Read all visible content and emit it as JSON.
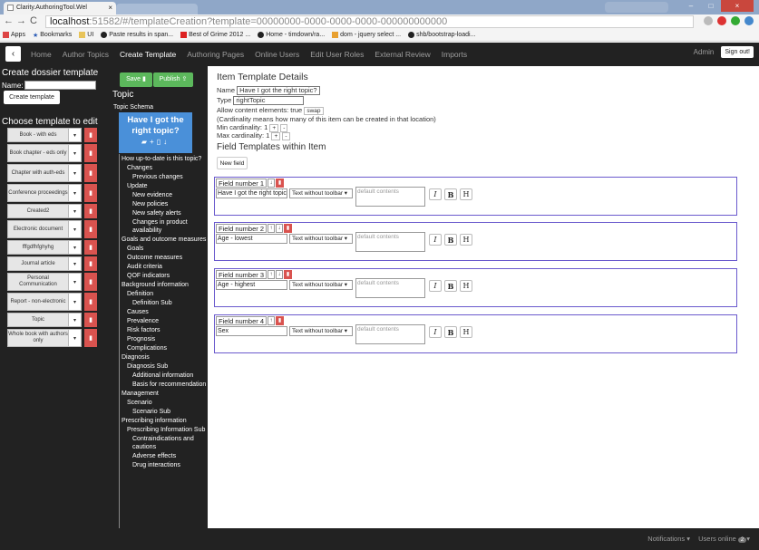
{
  "browser": {
    "tab_title": "Clarity.AuthoringTool.Wel",
    "url_host": "localhost",
    "url_rest": ":51582/#/templateCreation?template=00000000-0000-0000-0000-000000000000",
    "bookmarks": [
      "Apps",
      "Bookmarks",
      "UI",
      "Paste results in span...",
      "Best of Grime 2012 ...",
      "Home - timdown/ra...",
      "dom - jquery select ...",
      "shb/bootstrap-loadi..."
    ]
  },
  "nav": {
    "back_icon": "‹",
    "links": [
      "Home",
      "Author Topics",
      "Create Template",
      "Authoring Pages",
      "Online Users",
      "Edit User Roles",
      "External Review",
      "Imports"
    ],
    "active": "Create Template",
    "admin": "Admin",
    "signout": "Sign out!"
  },
  "left": {
    "create_heading": "Create dossier template",
    "name_label": "Name:",
    "create_button": "Create template",
    "choose_heading": "Choose template to edit",
    "templates": [
      "Book - with eds",
      "Book chapter - eds only",
      "Chapter with auth-eds",
      "Conference proceedings",
      "Created2",
      "Electronic document",
      "fffgdfhfghyhg",
      "Journal article",
      "Personal Communication",
      "Report - non-electronic",
      "Topic",
      "Whole book with authors only"
    ]
  },
  "middle": {
    "save": "Save",
    "publish": "Publish",
    "topic_heading": "Topic",
    "schema_label": "Topic Schema",
    "card_title": "Have I got the right topic?",
    "tree": [
      {
        "t": "How up-to-date is this topic?",
        "d": 0
      },
      {
        "t": "Changes",
        "d": 1
      },
      {
        "t": "Previous changes",
        "d": 2
      },
      {
        "t": "Update",
        "d": 1
      },
      {
        "t": "New evidence",
        "d": 2
      },
      {
        "t": "New policies",
        "d": 2
      },
      {
        "t": "New safety alerts",
        "d": 2
      },
      {
        "t": "Changes in product availability",
        "d": 2
      },
      {
        "t": "Goals and outcome measures",
        "d": 0
      },
      {
        "t": "Goals",
        "d": 1
      },
      {
        "t": "Outcome measures",
        "d": 1
      },
      {
        "t": "Audit criteria",
        "d": 1
      },
      {
        "t": "QOF indicators",
        "d": 1
      },
      {
        "t": "Background information",
        "d": 0
      },
      {
        "t": "Definition",
        "d": 1
      },
      {
        "t": "Definition Sub",
        "d": 2
      },
      {
        "t": "Causes",
        "d": 1
      },
      {
        "t": "Prevalence",
        "d": 1
      },
      {
        "t": "Risk factors",
        "d": 1
      },
      {
        "t": "Prognosis",
        "d": 1
      },
      {
        "t": "Complications",
        "d": 1
      },
      {
        "t": "Diagnosis",
        "d": 0
      },
      {
        "t": "Diagnosis Sub",
        "d": 1
      },
      {
        "t": "Additional information",
        "d": 2
      },
      {
        "t": "Basis for recommendation",
        "d": 2
      },
      {
        "t": "Management",
        "d": 0
      },
      {
        "t": "Scenario",
        "d": 1
      },
      {
        "t": "Scenario Sub",
        "d": 2
      },
      {
        "t": "Prescribing information",
        "d": 0
      },
      {
        "t": "Prescribing Information Sub",
        "d": 1
      },
      {
        "t": "Contraindications and cautions",
        "d": 2
      },
      {
        "t": "Adverse effects",
        "d": 2
      },
      {
        "t": "Drug interactions",
        "d": 2
      }
    ]
  },
  "main": {
    "heading": "Item Template Details",
    "name_label": "Name",
    "name_value": "Have I got the right topic?",
    "type_label": "Type",
    "type_value": "rightTopic",
    "allow_label": "Allow content elements: true",
    "swap": "swap",
    "cardinality_note": "(Cardinality means how many of this item can be created in that location)",
    "min_label": "Min cardinality: 1",
    "max_label": "Max cardinality: 1",
    "plus": "+",
    "minus": "-",
    "fields_heading": "Field Templates within Item",
    "new_field": "New field",
    "fields": [
      {
        "label": "Field number 1",
        "name": "Have I got the right topic?",
        "type": "Text without toolbar ▾",
        "placeholder": "default contents"
      },
      {
        "label": "Field number 2",
        "name": "Age - lowest",
        "type": "Text without toolbar ▾",
        "placeholder": "default contents"
      },
      {
        "label": "Field number 3",
        "name": "Age - highest",
        "type": "Text without toolbar ▾",
        "placeholder": "default contents"
      },
      {
        "label": "Field number 4",
        "name": "Sex",
        "type": "Text without toolbar ▾",
        "placeholder": "default contents"
      }
    ],
    "fmt_buttons": [
      "I",
      "B",
      "H"
    ]
  },
  "footer": {
    "notifications": "Notifications",
    "users_online": "Users online",
    "online_count": "2"
  },
  "colors": {
    "navbar": "#222222",
    "save_green": "#5cb85c",
    "delete_red": "#d9534f",
    "card_blue": "#4a90d9",
    "field_border": "#6a5acd"
  }
}
